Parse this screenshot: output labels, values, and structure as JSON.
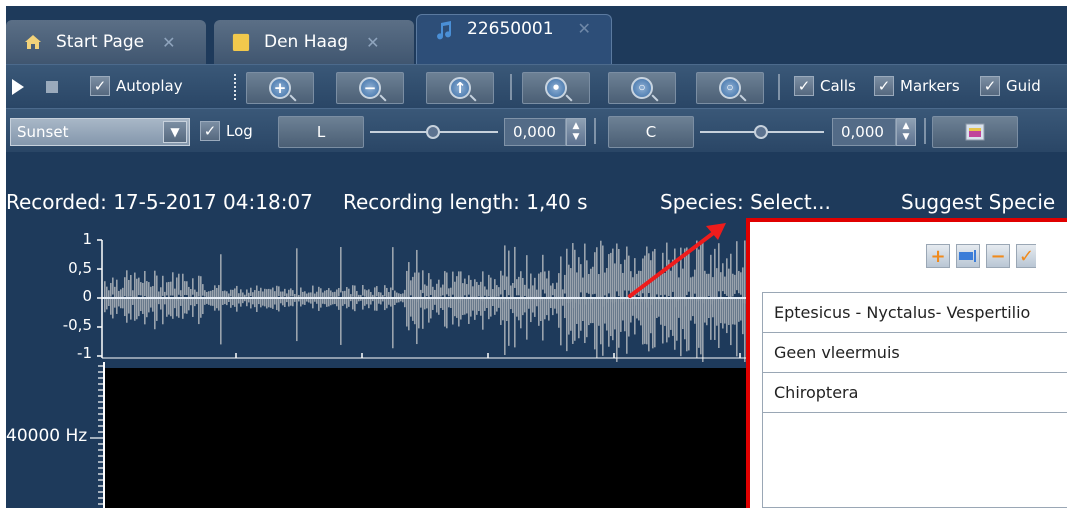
{
  "tabs": [
    {
      "label": "Start Page",
      "icon": "home-icon",
      "close": "✕"
    },
    {
      "label": "Den Haag",
      "icon": "folder-icon",
      "close": "✕"
    },
    {
      "label": "22650001",
      "icon": "music-note-icon",
      "close": "✕"
    }
  ],
  "toolbar": {
    "autoplay_label": "Autoplay",
    "calls_label": "Calls",
    "markers_label": "Markers",
    "guides_label": "Guid"
  },
  "controls": {
    "palette_value": "Sunset",
    "log_label": "Log",
    "l_label": "L",
    "l_value": "0,000",
    "l_slider_fraction": 0.5,
    "c_label": "C",
    "c_value": "0,000",
    "c_slider_fraction": 0.5
  },
  "info": {
    "recorded": "Recorded: 17-5-2017 04:18:07",
    "recording_length": "Recording length: 1,40 s",
    "species": "Species: Select...",
    "suggest": "Suggest Specie"
  },
  "waveform": {
    "y_ticks": [
      "1",
      "0,5",
      "0",
      "-0,5",
      "-1"
    ]
  },
  "spectrogram": {
    "label": "40000 Hz"
  },
  "species_popup": {
    "tool_icons": [
      "add-icon",
      "rename-icon",
      "remove-icon",
      "check-icon"
    ],
    "items": [
      "Eptesicus - Nyctalus- Vespertilio",
      "Geen vleermuis",
      "Chiroptera"
    ]
  },
  "colors": {
    "background": "#1e3a5b",
    "highlight": "#e00000"
  }
}
